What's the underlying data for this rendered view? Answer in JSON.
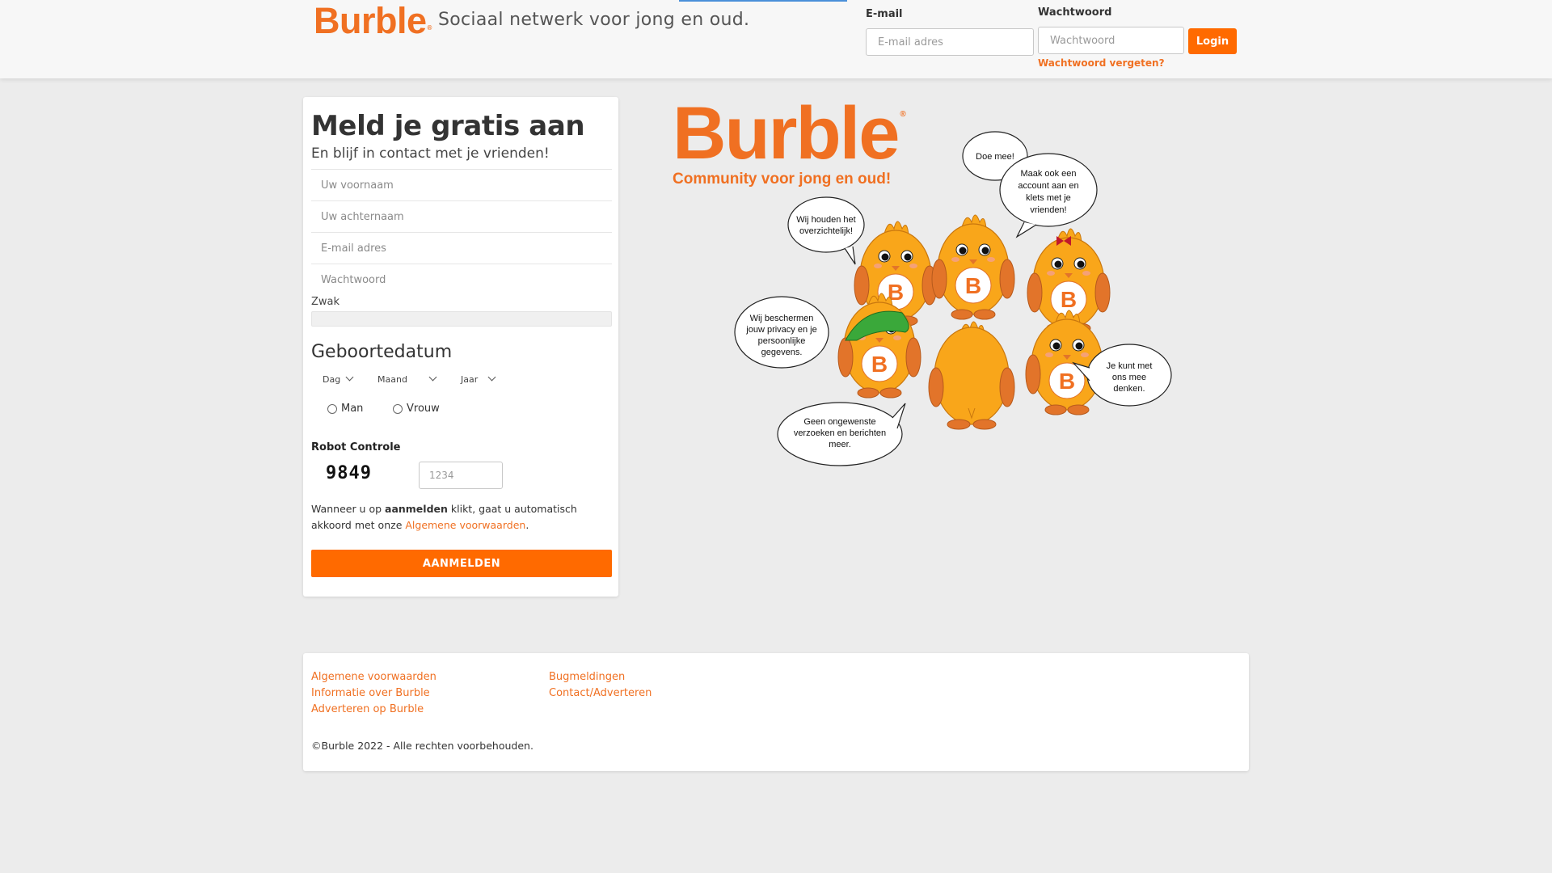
{
  "header": {
    "logo": "Burble",
    "logo_mark": "®",
    "tagline": "Sociaal netwerk voor jong en oud.",
    "email_label": "E-mail",
    "email_placeholder": "E-mail adres",
    "password_label": "Wachtwoord",
    "password_placeholder": "Wachtwoord",
    "login_label": "Login",
    "forgot_label": "Wachtwoord vergeten?"
  },
  "signup": {
    "title": "Meld je gratis aan",
    "subtitle": "En blijf in contact met je vrienden!",
    "firstname_placeholder": "Uw voornaam",
    "lastname_placeholder": "Uw achternaam",
    "email_placeholder": "E-mail adres",
    "password_placeholder": "Wachtwoord",
    "strength_label": "Zwak",
    "birthdate_title": "Geboortedatum",
    "day_label": "Dag",
    "month_label": "Maand",
    "year_label": "Jaar",
    "gender_male": "Man",
    "gender_female": "Vrouw",
    "robot_label": "Robot Controle",
    "captcha_code": "9849",
    "captcha_placeholder": "1234",
    "terms_part1": "Wanneer u op ",
    "terms_bold": "aanmelden",
    "terms_part2": " klikt, gaat u automatisch akkoord met onze ",
    "terms_link": "Algemene voorwaarden",
    "terms_end": ".",
    "submit_label": "AANMELDEN"
  },
  "illustration": {
    "logo": "Burble",
    "logo_mark": "®",
    "slogan": "Community voor jong en oud!",
    "bubbles": {
      "doe_mee": "Doe mee!",
      "maak_ook": [
        "Maak ook een",
        "account aan en",
        "klets met je",
        "vrienden!"
      ],
      "overzicht": [
        "Wij houden het",
        "overzichtelijk!"
      ],
      "privacy": [
        "Wij beschermen",
        "jouw privacy en je",
        "persoonlijke",
        "gegevens."
      ],
      "mee_denken": [
        "Je kunt met",
        "ons mee",
        "denken."
      ],
      "geen": [
        "Geen ongewenste",
        "verzoeken en berichten",
        "meer."
      ]
    },
    "chick_letter": "B"
  },
  "footer": {
    "links_col1": [
      "Algemene voorwaarden",
      "Informatie over Burble",
      "Adverteren op Burble"
    ],
    "links_col2": [
      "Bugmeldingen",
      "Contact/Adverteren"
    ],
    "copyright": "©Burble 2022 - Alle rechten voorbehouden."
  },
  "colors": {
    "brand": "#f07022",
    "button": "#ff6a00",
    "chick": "#f9a61a",
    "chick_dark": "#e2742a",
    "cap": "#3aa83a"
  }
}
